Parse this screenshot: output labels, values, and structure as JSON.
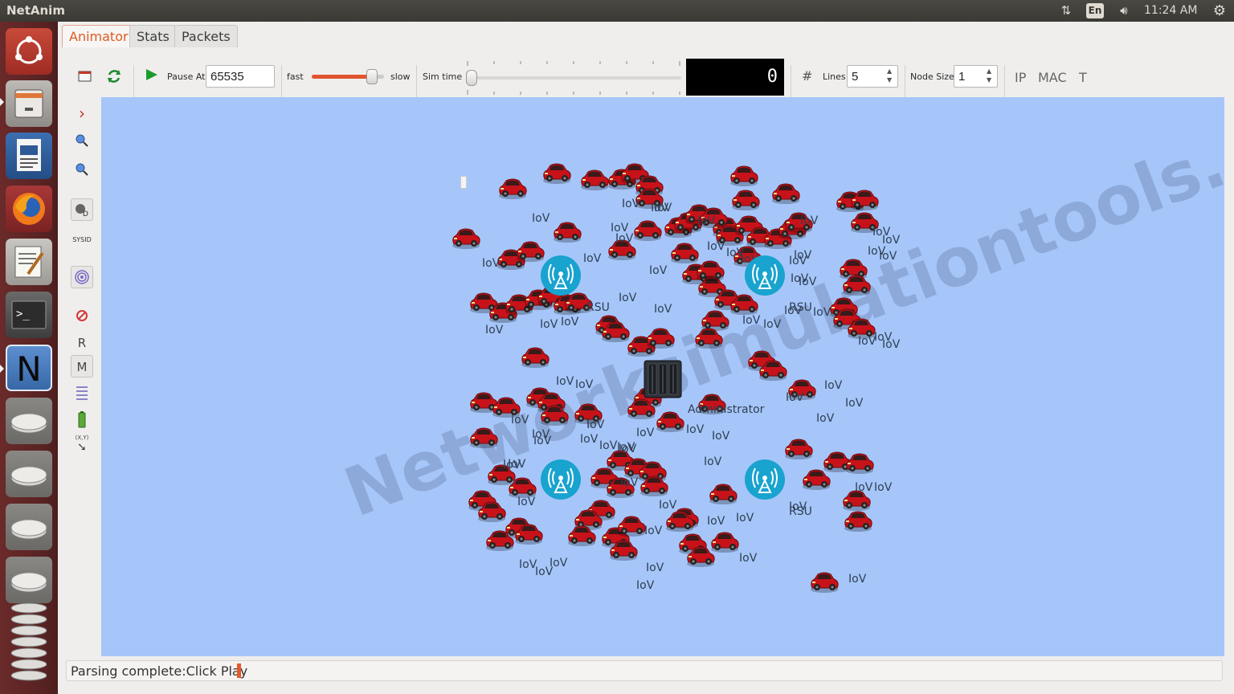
{
  "system_bar": {
    "app_name": "NetAnim",
    "language": "En",
    "time": "11:24 AM"
  },
  "launcher": {
    "items": [
      "ubuntu-dash",
      "files",
      "libreoffice-writer",
      "firefox",
      "text-editor",
      "terminal",
      "netanim",
      "drive-1",
      "drive-2",
      "drive-3",
      "drive-4",
      "drive-stack"
    ],
    "netanim_letter": "N"
  },
  "tabs": [
    {
      "label": "Animator",
      "active": true
    },
    {
      "label": "Stats",
      "active": false
    },
    {
      "label": "Packets",
      "active": false
    }
  ],
  "toolbar": {
    "pause_label": "Pause At",
    "pause_value": "65535",
    "fast_label": "fast",
    "slow_label": "slow",
    "speed_fraction": 0.83,
    "simtime_label": "Sim time",
    "simtime_fraction": 0.0,
    "time_display": "0",
    "lines_label": "Lines",
    "lines_value": "5",
    "nodesize_label": "Node Size",
    "nodesize_value": "1",
    "ip_label": "IP",
    "mac_label": "MAC",
    "t_label": "T"
  },
  "side_tools": {
    "r_label": "R",
    "m_label": "M",
    "sysid_label": "SYSID",
    "xy_label": "(X,Y)"
  },
  "canvas": {
    "background": "#a6c6fa",
    "vehicle_label": "IoV",
    "rsu_label": "RSU",
    "admin_label": "Administrator",
    "watermark": "Networksimulationtools.com"
  },
  "status": {
    "text": "Parsing complete:Click Play"
  }
}
